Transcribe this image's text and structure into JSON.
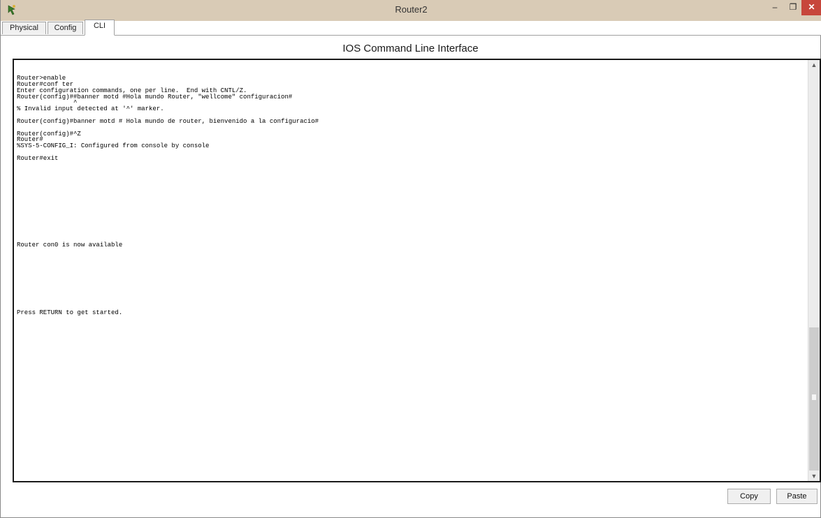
{
  "window": {
    "title": "Router2",
    "controls": {
      "minimize": "–",
      "maximize": "❐",
      "close": "✕"
    },
    "icon": "packet-tracer-router-icon"
  },
  "tabs": [
    {
      "label": "Physical",
      "active": false
    },
    {
      "label": "Config",
      "active": false
    },
    {
      "label": "CLI",
      "active": true
    }
  ],
  "cli": {
    "heading": "IOS Command Line Interface",
    "output": "\n\n\n\n\n\n\n\n\n\n\n\n\n\n\n\n\n\n\n\n\n\n\n\n\n\n\n\n\n\n\n\n\n\n\n\n\n\n\n\n\n\n\n\n\n\n\n\n\n\n\n\n\n\n\n\n\n\n\n\n\n\n\n\n\n\n\n\nPress RETURN to get started.\n\n\n\n\n\n\n\n\n\n\n\n\n\n\n\n\n\n\n\n\n\n\n\n\n\n\n",
    "lines": [
      "Router>enable",
      "Router#conf ter",
      "Enter configuration commands, one per line.  End with CNTL/Z.",
      "Router(config)##banner motd #Hola mundo Router, \"wellcome\" configuracion#",
      "               ^",
      "% Invalid input detected at '^' marker.",
      "",
      "Router(config)#banner motd # Hola mundo de router, bienvenido a la configuracio#",
      "",
      "Router(config)#^Z",
      "Router#",
      "%SYS-5-CONFIG_I: Configured from console by console",
      "",
      "Router#exit",
      "",
      "",
      "",
      "",
      "",
      "",
      "",
      "",
      "",
      "",
      "",
      "",
      "",
      "Router con0 is now available",
      "",
      "",
      "",
      "",
      "",
      "",
      "",
      "",
      "",
      "",
      "Press RETURN to get started."
    ]
  },
  "buttons": {
    "copy": "Copy",
    "paste": "Paste"
  },
  "colors": {
    "titlebar": "#d9cbb6",
    "close_button": "#c7463b"
  }
}
